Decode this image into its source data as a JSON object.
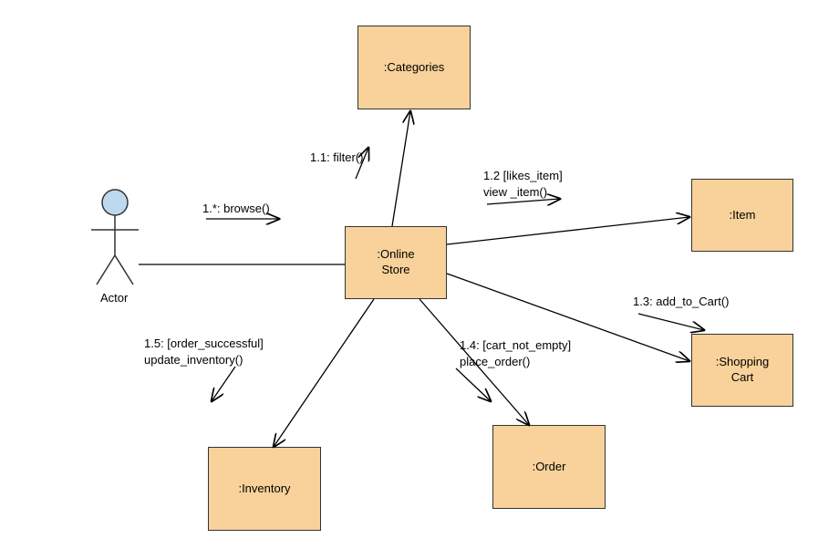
{
  "nodes": {
    "actor": {
      "label": "Actor"
    },
    "online_store": {
      "label": ":Online\nStore"
    },
    "categories": {
      "label": ":Categories"
    },
    "item": {
      "label": ":Item"
    },
    "shopping_cart": {
      "label": ":Shopping\nCart"
    },
    "order": {
      "label": ":Order"
    },
    "inventory": {
      "label": ":Inventory"
    }
  },
  "messages": {
    "m1": {
      "label": "1.*: browse()"
    },
    "m11": {
      "label": "1.1: filter()"
    },
    "m12": {
      "line1": "1.2 [likes_item]",
      "line2": "view _item()"
    },
    "m13": {
      "label": "1.3: add_to_Cart()"
    },
    "m14": {
      "line1": "1.4: [cart_not_empty]",
      "line2": "place_order()"
    },
    "m15": {
      "line1": "1.5: [order_successful]",
      "line2": "update_inventory()"
    }
  }
}
